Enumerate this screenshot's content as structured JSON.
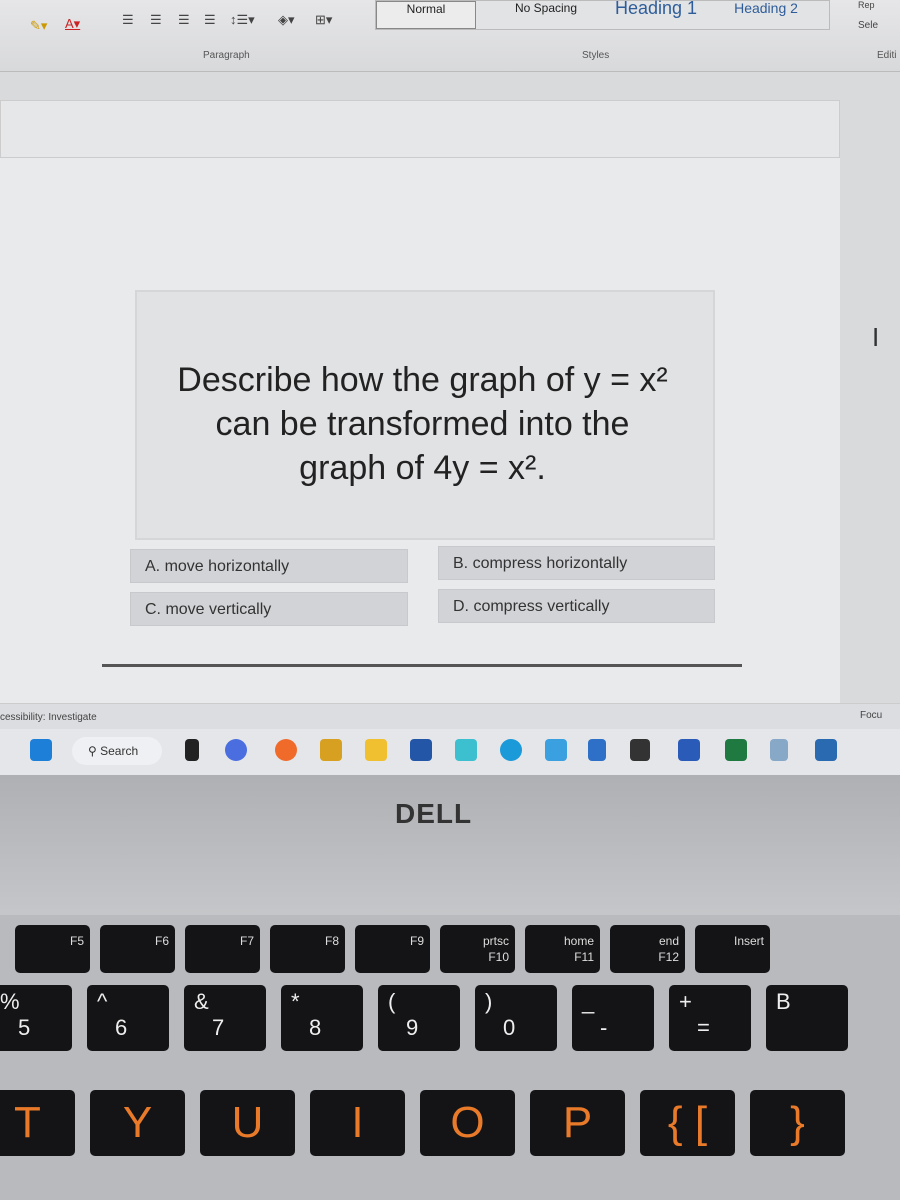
{
  "ribbon": {
    "styles": [
      "Normal",
      "No Spacing",
      "Heading 1",
      "Heading 2"
    ],
    "groups": {
      "paragraph": "Paragraph",
      "styles": "Styles",
      "editing": "Editi"
    },
    "editing": {
      "replace": "Rep",
      "select": "Sele"
    }
  },
  "question": {
    "line1": "Describe how the graph of y = x²",
    "line2": "can be transformed into the",
    "line3": "graph of 4y = x²."
  },
  "options": [
    {
      "label": "A. move horizontally"
    },
    {
      "label": "B. compress horizontally"
    },
    {
      "label": "C. move vertically"
    },
    {
      "label": "D. compress vertically"
    }
  ],
  "status": {
    "accessibility": "cessibility: Investigate",
    "focus": "Focu"
  },
  "taskbar": {
    "search": "Search",
    "apps": [
      "start",
      "files-l",
      "meet",
      "firefox",
      "puzzle",
      "file-explorer",
      "store",
      "teal-app",
      "edge",
      "mail",
      "h-app",
      "amazon",
      "word",
      "excel",
      "snipping",
      "a-app"
    ]
  },
  "brand": "DELL",
  "keyboard": {
    "fkeys": [
      {
        "top": "",
        "label": "F5"
      },
      {
        "top": "",
        "label": "F6"
      },
      {
        "top": "",
        "label": "F7"
      },
      {
        "top": "",
        "label": "F8"
      },
      {
        "top": "",
        "label": "F9"
      },
      {
        "top": "prtsc",
        "label": "F10"
      },
      {
        "top": "home",
        "label": "F11"
      },
      {
        "top": "end",
        "label": "F12"
      },
      {
        "top": "Insert",
        "label": ""
      }
    ],
    "numkeys": [
      {
        "top": "%",
        "bot": "5"
      },
      {
        "top": "^",
        "bot": "6"
      },
      {
        "top": "&",
        "bot": "7"
      },
      {
        "top": "*",
        "bot": "8"
      },
      {
        "top": "(",
        "bot": "9"
      },
      {
        "top": ")",
        "bot": "0"
      },
      {
        "top": "_",
        "bot": "-"
      },
      {
        "top": "+",
        "bot": "="
      },
      {
        "top": "B",
        "bot": ""
      }
    ],
    "letters": [
      "T",
      "Y",
      "U",
      "I",
      "O",
      "P",
      "{ [",
      "}"
    ]
  }
}
